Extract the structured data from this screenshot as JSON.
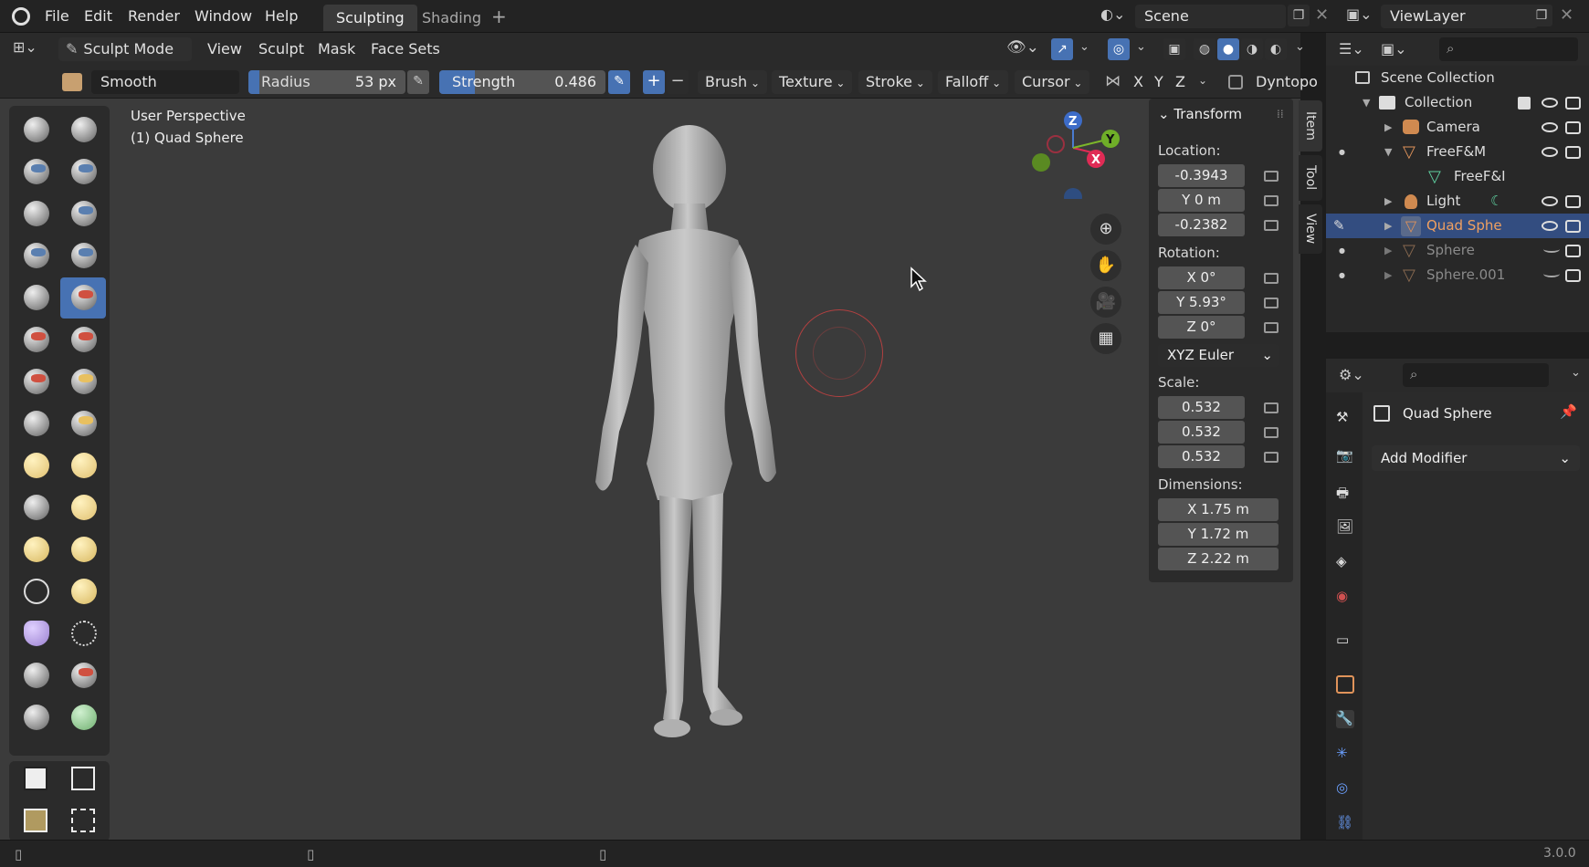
{
  "menu": [
    "File",
    "Edit",
    "Render",
    "Window",
    "Help"
  ],
  "workspace_tabs": [
    "Sculpting",
    "Shading"
  ],
  "scene_name": "Scene",
  "view_layer": "ViewLayer",
  "header": {
    "mode": "Sculpt Mode",
    "menus": [
      "View",
      "Sculpt",
      "Mask",
      "Face Sets"
    ]
  },
  "tool_settings": {
    "brush_name": "Smooth",
    "radius_label": "Radius",
    "radius_value": "53 px",
    "strength_label": "Strength",
    "strength_value": "0.486",
    "strength_fraction": 0.486,
    "dropdowns": [
      "Brush",
      "Texture",
      "Stroke",
      "Falloff",
      "Cursor"
    ],
    "axes": [
      "X",
      "Y",
      "Z"
    ],
    "dyntopo": "Dyntopo"
  },
  "viewport": {
    "perspective": "User Perspective",
    "object": "(1) Quad Sphere"
  },
  "gizmo": {
    "x": "X",
    "y": "Y",
    "z": "Z"
  },
  "npanel": {
    "tabs": [
      "Item",
      "Tool",
      "View"
    ],
    "section": "Transform",
    "location_label": "Location:",
    "location": [
      "-0.3943",
      "Y    0 m",
      "-0.2382"
    ],
    "rotation_label": "Rotation:",
    "rotation": [
      "X     0°",
      "Y  5.93°",
      "Z     0°"
    ],
    "rotation_mode": "XYZ Euler",
    "scale_label": "Scale:",
    "scale": [
      "0.532",
      "0.532",
      "0.532"
    ],
    "dimensions_label": "Dimensions:",
    "dimensions": [
      "X      1.75 m",
      "Y      1.72 m",
      "Z      2.22 m"
    ]
  },
  "outliner": {
    "root": "Scene Collection",
    "items": [
      "Collection",
      "Camera",
      "FreeF&M",
      "FreeF&I",
      "Light",
      "Quad Sphe",
      "Sphere",
      "Sphere.001"
    ]
  },
  "properties": {
    "object_name": "Quad Sphere",
    "add_modifier": "Add Modifier"
  },
  "version": "3.0.0",
  "colors": {
    "accent": "#4772b3",
    "selection": "#334d80",
    "bg": "#3b3b3b"
  }
}
